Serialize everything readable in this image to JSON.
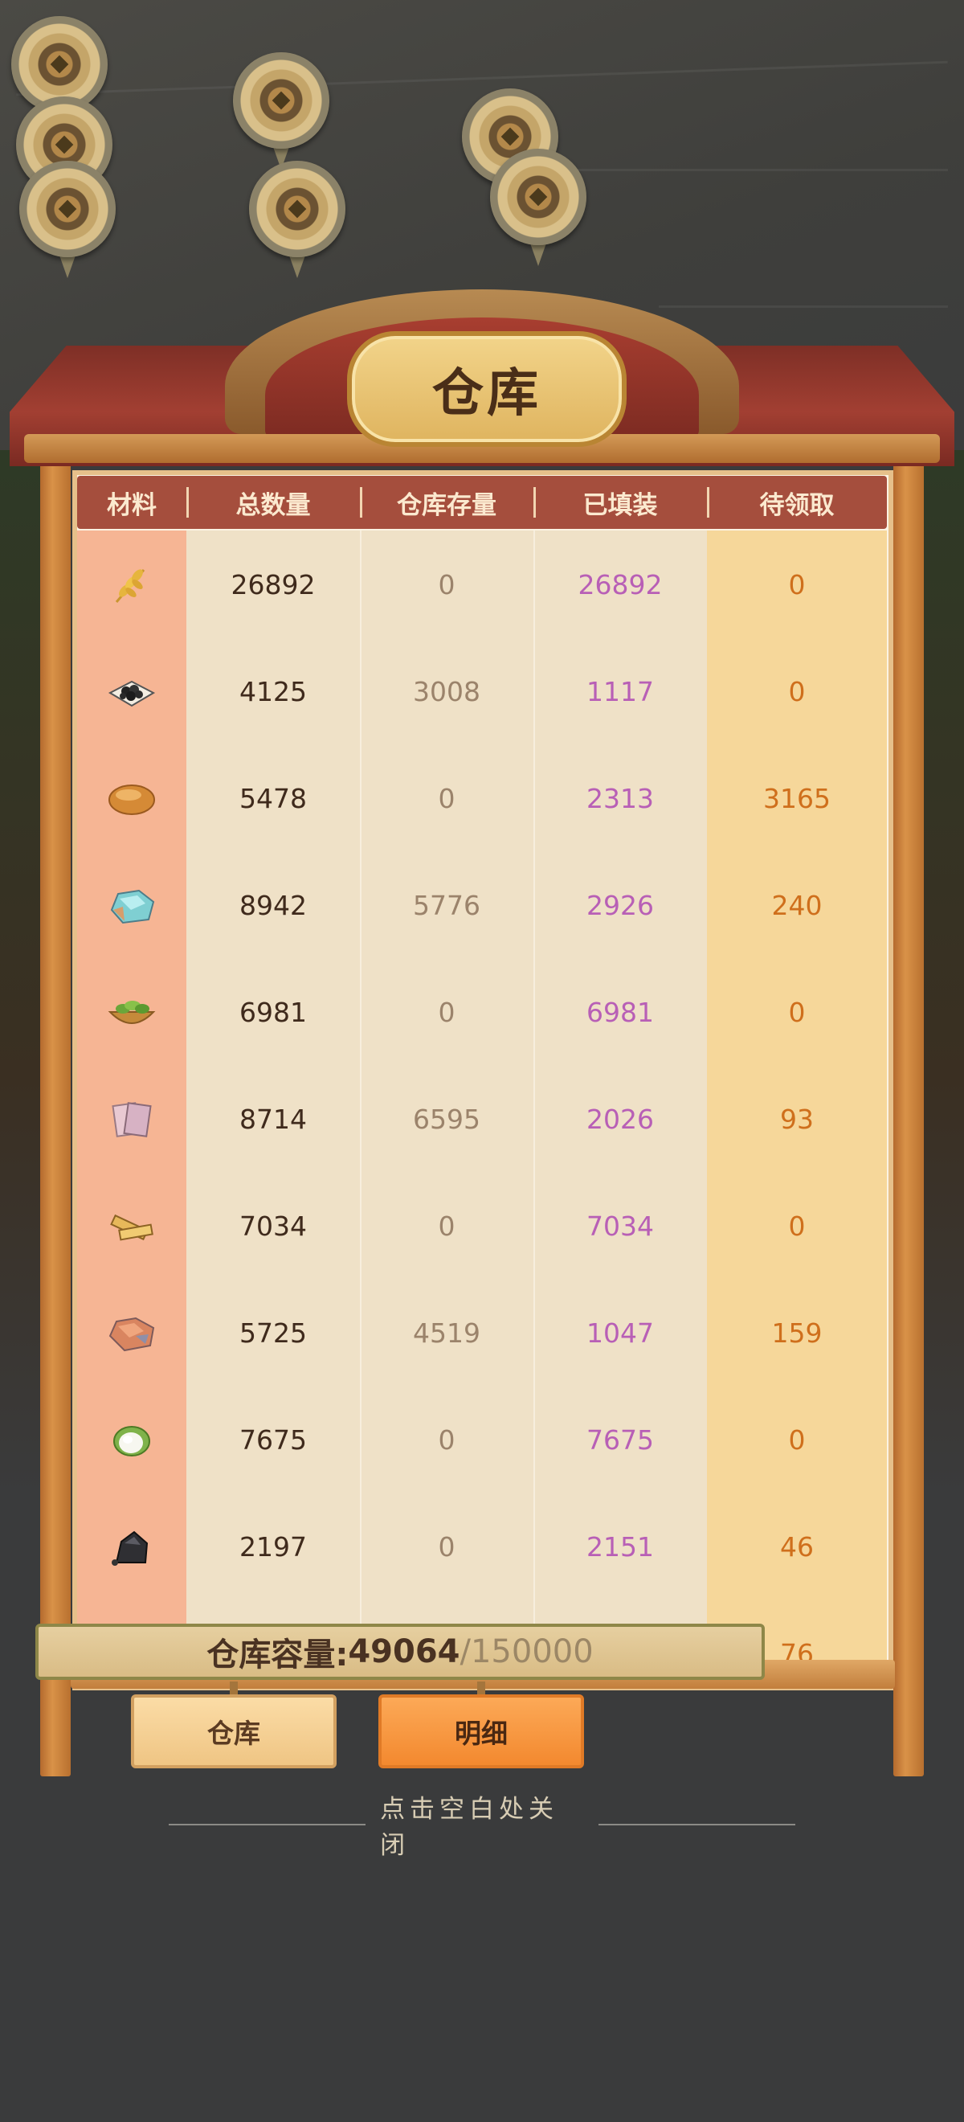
{
  "title": "仓库",
  "columns": [
    "材料",
    "总数量",
    "仓库存量",
    "已填装",
    "待领取"
  ],
  "rows": [
    {
      "icon": "wheat-icon",
      "total": "26892",
      "stock": "0",
      "filled": "26892",
      "pending": "0"
    },
    {
      "icon": "coal-icon",
      "total": "4125",
      "stock": "3008",
      "filled": "1117",
      "pending": "0"
    },
    {
      "icon": "bread-icon",
      "total": "5478",
      "stock": "0",
      "filled": "2313",
      "pending": "3165"
    },
    {
      "icon": "jade-ore-icon",
      "total": "8942",
      "stock": "5776",
      "filled": "2926",
      "pending": "240"
    },
    {
      "icon": "vegetable-bowl-icon",
      "total": "6981",
      "stock": "0",
      "filled": "6981",
      "pending": "0"
    },
    {
      "icon": "paper-sheets-icon",
      "total": "8714",
      "stock": "6595",
      "filled": "2026",
      "pending": "93"
    },
    {
      "icon": "wood-planks-icon",
      "total": "7034",
      "stock": "0",
      "filled": "7034",
      "pending": "0"
    },
    {
      "icon": "copper-ore-icon",
      "total": "5725",
      "stock": "4519",
      "filled": "1047",
      "pending": "159"
    },
    {
      "icon": "cotton-icon",
      "total": "7675",
      "stock": "0",
      "filled": "7675",
      "pending": "0"
    },
    {
      "icon": "iron-ore-icon",
      "total": "2197",
      "stock": "0",
      "filled": "2151",
      "pending": "46"
    },
    {
      "icon": "unknown-icon",
      "total": "",
      "stock": "",
      "filled": "",
      "pending": "76"
    }
  ],
  "capacity": {
    "label": "仓库容量:",
    "current": "49064",
    "max": "/150000"
  },
  "buttons": {
    "warehouse": "仓库",
    "detail": "明细"
  },
  "close_hint": "点击空白处关闭",
  "colors": {
    "header": "#a54e3d",
    "total": "#3f2a1c",
    "stock": "#9b836b",
    "filled": "#b85fb6",
    "pending": "#cf6f1c",
    "detail_button": "#f3892f"
  }
}
